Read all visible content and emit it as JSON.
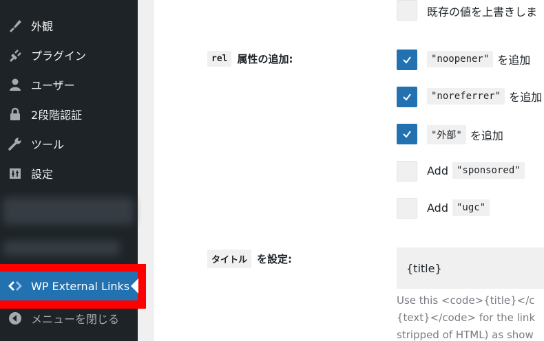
{
  "sidebar": {
    "items": [
      {
        "label": "外観",
        "icon": "paintbrush-icon"
      },
      {
        "label": "プラグイン",
        "icon": "plugin-icon"
      },
      {
        "label": "ユーザー",
        "icon": "user-icon"
      },
      {
        "label": "2段階認証",
        "icon": "lock-icon"
      },
      {
        "label": "ツール",
        "icon": "wrench-icon"
      },
      {
        "label": "設定",
        "icon": "settings-icon"
      }
    ],
    "active_item": {
      "label": "WP External Links",
      "icon": "code-arrows-icon"
    },
    "collapse_label": "メニューを閉じる"
  },
  "top_option": {
    "label": "既存の値を上書きしま",
    "checked": false
  },
  "rel_section": {
    "chip": "rel",
    "label": "属性の追加:",
    "options": [
      {
        "code": "\"noopener\"",
        "suffix": "を追加",
        "checked": true
      },
      {
        "code": "\"noreferrer\"",
        "suffix": "を追加",
        "checked": true
      },
      {
        "code": "\"外部\"",
        "suffix": "を追加",
        "checked": true
      },
      {
        "prefix": "Add",
        "code": "\"sponsored\"",
        "checked": false
      },
      {
        "prefix": "Add",
        "code": "\"ugc\"",
        "checked": false
      }
    ]
  },
  "title_section": {
    "chip": "タイトル",
    "label": "を設定:",
    "value": "{title}",
    "help": [
      "Use this <code>{title}</c",
      "{text}</code> for the link",
      "stripped of HTML) as show"
    ]
  },
  "colors": {
    "accent": "#2271b1",
    "highlight": "#ff0000",
    "sidebar_bg": "#1d2327"
  }
}
